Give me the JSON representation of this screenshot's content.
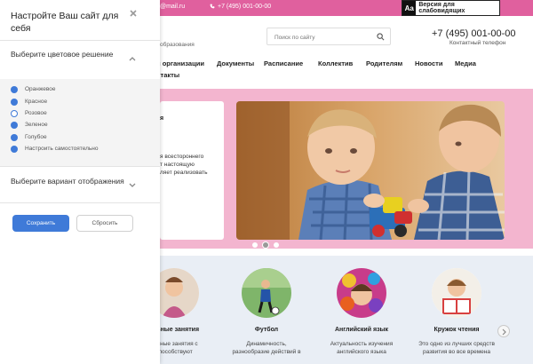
{
  "topbar": {
    "email": "@mail.ru",
    "phone": "+7 (495) 001-00-00",
    "accessibility_icon": "Aa",
    "accessibility_label": "Версия для слабовидящих"
  },
  "header": {
    "org_subtitle": "образования",
    "search_placeholder": "Поиск по сайту",
    "phone": "+7 (495) 001-00-00",
    "phone_label": "Контактный телефон"
  },
  "nav": {
    "items": [
      "й организации",
      "Документы",
      "Расписание",
      "Коллектив",
      "Родителям",
      "Новости",
      "Медиа",
      "нтакты"
    ]
  },
  "hero": {
    "card_title": "я",
    "card_text": [
      "я всестороннего",
      "т настоящую",
      "ляет реализовать"
    ],
    "slides": 3,
    "active_slide": 2
  },
  "activities": [
    {
      "name": "альные занятия",
      "desc": [
        "альные занятия с",
        "способствуют"
      ]
    },
    {
      "name": "Футбол",
      "desc": [
        "Динамичность,",
        "разнообразие действий в"
      ]
    },
    {
      "name": "Английский язык",
      "desc": [
        "Актуальность изучения",
        "английского языка"
      ]
    },
    {
      "name": "Кружок чтения",
      "desc": [
        "Это одно из лучших средств",
        "развития во все времена"
      ]
    }
  ],
  "panel": {
    "title": "Настройте Ваш сайт для себя",
    "color_section": "Выберите цветовое решение",
    "options": [
      "Оранжевое",
      "Красное",
      "Розовое",
      "Зеленое",
      "Голубое",
      "Настроить самостоятельно"
    ],
    "selected_option": "Розовое",
    "display_section": "Выберите вариант отображения",
    "save": "Сохранить",
    "reset": "Сбросить"
  },
  "colors": {
    "topbar": "#e0609e",
    "hero_bg": "#f3b5cf",
    "accent_blue": "#3f7ad8",
    "activities_bg": "#e9eef5"
  }
}
